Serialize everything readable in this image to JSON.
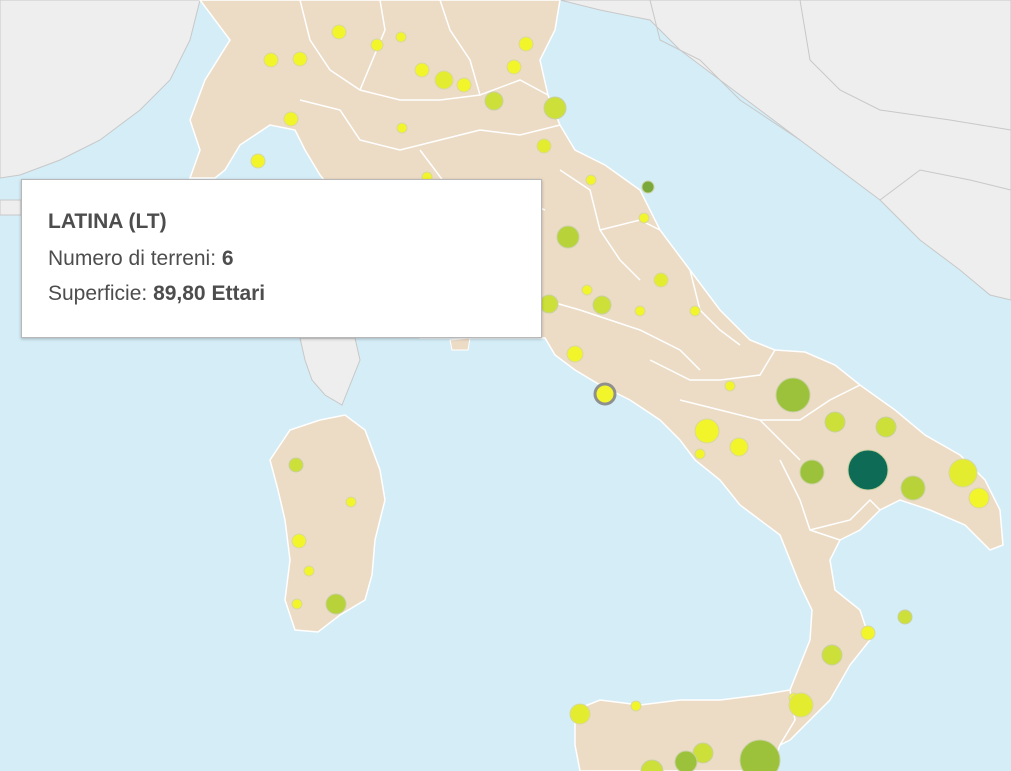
{
  "tooltip": {
    "title": "LATINA (LT)",
    "terreni_label": "Numero di terreni:",
    "terreni_value": "6",
    "superficie_label": "Superficie:",
    "superficie_value": "89,80 Ettari"
  },
  "colors": {
    "sea": "#d4edf6",
    "italy_land": "#ecdcc6",
    "foreign_land": "#eeeeee",
    "region_border": "#ffffff",
    "low_density": "#f2f52a",
    "mid_density": "#cde03a",
    "high_density": "#9cc23b",
    "highest_density": "#0e6b55"
  }
}
